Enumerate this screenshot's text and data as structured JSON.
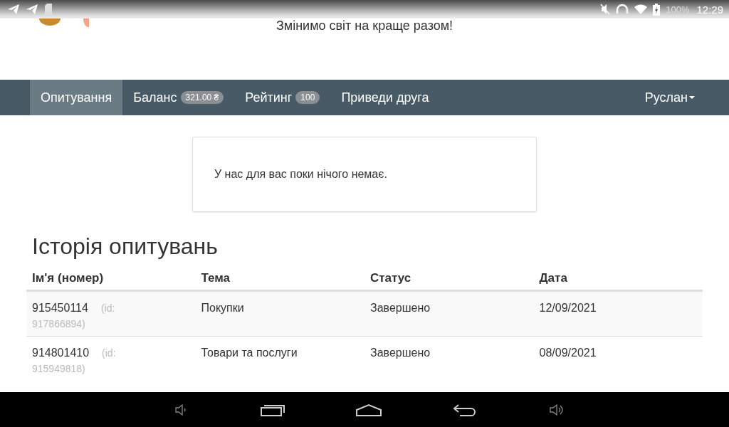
{
  "status_bar": {
    "battery_text": "100%",
    "time": "12:29"
  },
  "header": {
    "slogan": "Змінимо світ на краще разом!"
  },
  "nav": {
    "items": [
      {
        "label": "Опитування",
        "selected": true
      },
      {
        "label": "Баланс",
        "badge": "321.00 ₴",
        "selected": false
      },
      {
        "label": "Рейтинг",
        "badge": "100",
        "selected": false
      },
      {
        "label": "Приведи друга",
        "selected": false
      }
    ],
    "user": "Руслан"
  },
  "notice": "У нас для вас поки нічого немає.",
  "history": {
    "title": "Історія опитувань",
    "columns": [
      "Ім'я (номер)",
      "Тема",
      "Статус",
      "Дата"
    ],
    "rows": [
      {
        "number": "915450114",
        "id": "(id: 917866894)",
        "topic": "Покупки",
        "status": "Завершено",
        "date": "12/09/2021"
      },
      {
        "number": "914801410",
        "id": "(id: 915949818)",
        "topic": "Товари та послуги",
        "status": "Завершено",
        "date": "08/09/2021"
      }
    ]
  }
}
